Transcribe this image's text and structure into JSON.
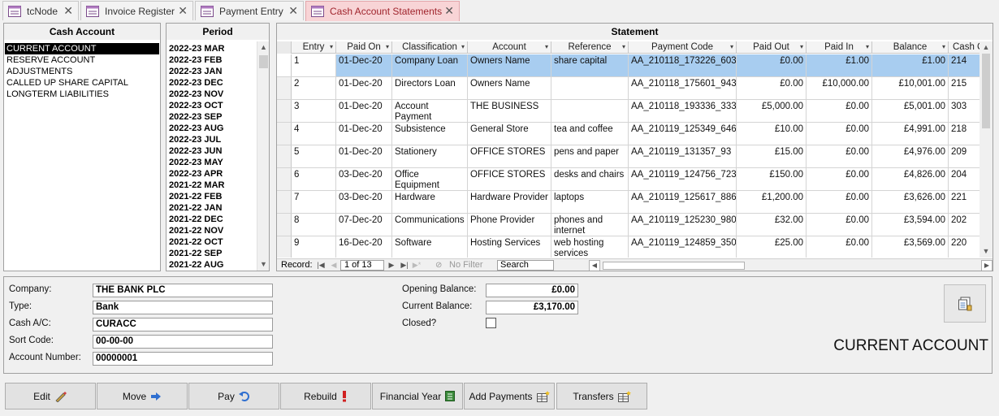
{
  "tabs": [
    {
      "label": "tcNode",
      "close": "✕"
    },
    {
      "label": "Invoice Register",
      "close": "✕"
    },
    {
      "label": "Payment Entry",
      "close": "✕"
    },
    {
      "label": "Cash Account Statements",
      "close": "✕"
    }
  ],
  "cash_account": {
    "title": "Cash Account",
    "items": [
      "CURRENT ACCOUNT",
      "RESERVE ACCOUNT",
      "ADJUSTMENTS",
      "CALLED UP SHARE CAPITAL",
      "LONGTERM LIABILITIES"
    ],
    "selected": "CURRENT ACCOUNT"
  },
  "period": {
    "title": "Period",
    "items": [
      "2022-23 MAR",
      "2022-23 FEB",
      "2022-23 JAN",
      "2022-23 DEC",
      "2022-23 NOV",
      "2022-23 OCT",
      "2022-23 SEP",
      "2022-23 AUG",
      "2022-23 JUL",
      "2022-23 JUN",
      "2022-23 MAY",
      "2022-23 APR",
      "2021-22 MAR",
      "2021-22 FEB",
      "2021-22 JAN",
      "2021-22 DEC",
      "2021-22 NOV",
      "2021-22 OCT",
      "2021-22 SEP",
      "2021-22 AUG"
    ]
  },
  "statement": {
    "title": "Statement",
    "columns": [
      "Entry",
      "Paid On",
      "Classification",
      "Account",
      "Reference",
      "Payment Code",
      "Paid Out",
      "Paid In",
      "Balance",
      "Cash C"
    ],
    "rows": [
      {
        "entry": "1",
        "paid_on": "01-Dec-20",
        "classification": "Company Loan",
        "account": "Owners Name",
        "reference": "share capital",
        "payment_code": "AA_210118_173226_603",
        "paid_out": "£0.00",
        "paid_in": "£1.00",
        "balance": "£1.00",
        "cash_c": "214"
      },
      {
        "entry": "2",
        "paid_on": "01-Dec-20",
        "classification": "Directors Loan",
        "account": "Owners Name",
        "reference": "",
        "payment_code": "AA_210118_175601_943",
        "paid_out": "£0.00",
        "paid_in": "£10,000.00",
        "balance": "£10,001.00",
        "cash_c": "215"
      },
      {
        "entry": "3",
        "paid_on": "01-Dec-20",
        "classification": "Account Payment",
        "account": "THE BUSINESS",
        "reference": "",
        "payment_code": "AA_210118_193336_333",
        "paid_out": "£5,000.00",
        "paid_in": "£0.00",
        "balance": "£5,001.00",
        "cash_c": "303"
      },
      {
        "entry": "4",
        "paid_on": "01-Dec-20",
        "classification": "Subsistence",
        "account": "General Store",
        "reference": "tea and coffee",
        "payment_code": "AA_210119_125349_646",
        "paid_out": "£10.00",
        "paid_in": "£0.00",
        "balance": "£4,991.00",
        "cash_c": "218"
      },
      {
        "entry": "5",
        "paid_on": "01-Dec-20",
        "classification": "Stationery",
        "account": "OFFICE STORES",
        "reference": "pens and paper",
        "payment_code": "AA_210119_131357_93",
        "paid_out": "£15.00",
        "paid_in": "£0.00",
        "balance": "£4,976.00",
        "cash_c": "209"
      },
      {
        "entry": "6",
        "paid_on": "03-Dec-20",
        "classification": "Office Equipment",
        "account": "OFFICE STORES",
        "reference": "desks and chairs",
        "payment_code": "AA_210119_124756_723",
        "paid_out": "£150.00",
        "paid_in": "£0.00",
        "balance": "£4,826.00",
        "cash_c": "204"
      },
      {
        "entry": "7",
        "paid_on": "03-Dec-20",
        "classification": "Hardware",
        "account": "Hardware Provider",
        "reference": "laptops",
        "payment_code": "AA_210119_125617_886",
        "paid_out": "£1,200.00",
        "paid_in": "£0.00",
        "balance": "£3,626.00",
        "cash_c": "221"
      },
      {
        "entry": "8",
        "paid_on": "07-Dec-20",
        "classification": "Communications",
        "account": "Phone Provider",
        "reference": "phones and internet",
        "payment_code": "AA_210119_125230_980",
        "paid_out": "£32.00",
        "paid_in": "£0.00",
        "balance": "£3,594.00",
        "cash_c": "202"
      },
      {
        "entry": "9",
        "paid_on": "16-Dec-20",
        "classification": "Software",
        "account": "Hosting Services",
        "reference": "web hosting services",
        "payment_code": "AA_210119_124859_350",
        "paid_out": "£25.00",
        "paid_in": "£0.00",
        "balance": "£3,569.00",
        "cash_c": "220"
      }
    ],
    "nav": {
      "record_label": "Record:",
      "record_value": "1 of 13",
      "no_filter": "No Filter",
      "search": "Search"
    }
  },
  "details": {
    "company_label": "Company:",
    "company": "THE BANK PLC",
    "type_label": "Type:",
    "type": "Bank",
    "cash_ac_label": "Cash A/C:",
    "cash_ac": "CURACC",
    "sort_code_label": "Sort Code:",
    "sort_code": "00-00-00",
    "account_number_label": "Account Number:",
    "account_number": "00000001",
    "opening_balance_label": "Opening Balance:",
    "opening_balance": "£0.00",
    "current_balance_label": "Current Balance:",
    "current_balance": "£3,170.00",
    "closed_label": "Closed?",
    "account_title": "CURRENT ACCOUNT"
  },
  "buttons": [
    "Edit",
    "Move",
    "Pay",
    "Rebuild",
    "Financial Year",
    "Add Payments",
    "Transfers"
  ],
  "colors": {
    "active_tab": "#f8d4d6",
    "selected_row": "#a8cdf0",
    "tab_accent": "#a0252d"
  }
}
